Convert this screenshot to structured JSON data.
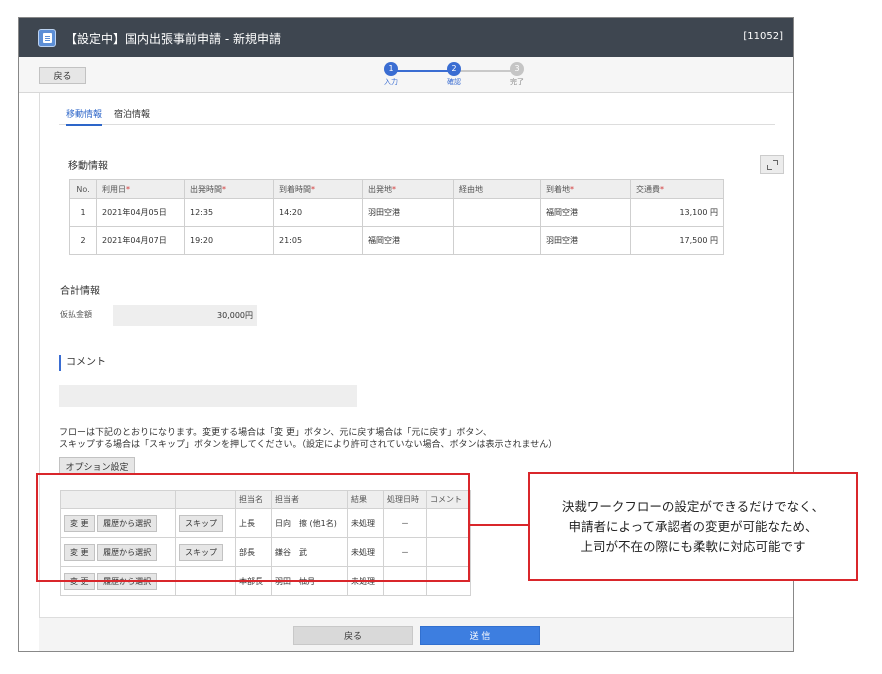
{
  "window": {
    "title": "【設定中】国内出張事前申請 - 新規申請",
    "form_id": "[11052]"
  },
  "toolbar": {
    "back_label": "戻る"
  },
  "stepper": {
    "steps": [
      {
        "num": "1",
        "label": "入力",
        "state": "done"
      },
      {
        "num": "2",
        "label": "確認",
        "state": "current"
      },
      {
        "num": "3",
        "label": "完了",
        "state": "pending"
      }
    ],
    "accent_color": "#3a6dd2"
  },
  "tabs": [
    {
      "label": "移動情報",
      "active": true
    },
    {
      "label": "宿泊情報",
      "active": false
    }
  ],
  "movement": {
    "title": "移動情報",
    "required_mark": "*",
    "columns": [
      "No.",
      "利用日",
      "出発時間",
      "到着時間",
      "出発地",
      "経由地",
      "到着地",
      "交通費"
    ],
    "rows": [
      {
        "no": "1",
        "date": "2021年04月05日",
        "depart_time": "12:35",
        "arrive_time": "14:20",
        "from": "羽田空港",
        "via": "",
        "to": "福岡空港",
        "fare": "13,100 円"
      },
      {
        "no": "2",
        "date": "2021年04月07日",
        "depart_time": "19:20",
        "arrive_time": "21:05",
        "from": "福岡空港",
        "via": "",
        "to": "羽田空港",
        "fare": "17,500 円"
      }
    ]
  },
  "summary": {
    "title": "合計情報",
    "advance_label": "仮払金額",
    "advance_value": "30,000円"
  },
  "comment": {
    "title": "コメント",
    "value": ""
  },
  "note": {
    "line1": "フローは下記のとおりになります。変更する場合は「変 更」ボタン、元に戻す場合は「元に戻す」ボタン、",
    "line2": "スキップする場合は「スキップ」ボタンを押してください。（設定により許可されていない場合、ボタンは表示されません）"
  },
  "option_button": "オプション設定",
  "flow": {
    "columns": [
      "",
      "",
      "担当名",
      "担当者",
      "結果",
      "処理日時",
      "コメント"
    ],
    "change_label": "変 更",
    "history_label": "履歴から選択",
    "skip_label": "スキップ",
    "rows": [
      {
        "role": "上長",
        "person": "日向　擦 (他1名)",
        "result": "未処理",
        "date": "－",
        "comment": "",
        "skip": true
      },
      {
        "role": "部長",
        "person": "鎌谷　武",
        "result": "未処理",
        "date": "－",
        "comment": "",
        "skip": true
      },
      {
        "role": "本部長",
        "person": "羽田　柚月",
        "result": "未処理",
        "date": "－",
        "comment": "",
        "skip": false
      }
    ]
  },
  "callout": {
    "line1": "決裁ワークフローの設定ができるだけでなく、",
    "line2": "申請者によって承認者の変更が可能なため、",
    "line3": "上司が不在の際にも柔軟に対応可能です",
    "color": "#d9262b"
  },
  "footer": {
    "back_label": "戻る",
    "send_label": "送 信"
  }
}
